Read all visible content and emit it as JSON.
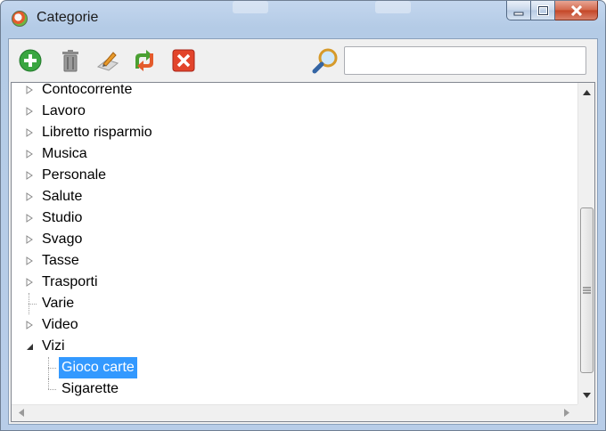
{
  "window": {
    "title": "Categorie"
  },
  "toolbar": {
    "buttons": [
      {
        "name": "add",
        "icon": "add-icon",
        "color": "#3aa641"
      },
      {
        "name": "delete",
        "icon": "trash-icon",
        "color": "#6f6f6f"
      },
      {
        "name": "edit",
        "icon": "edit-icon",
        "color": "#e89a2a"
      },
      {
        "name": "refresh",
        "icon": "refresh-icon",
        "color": "#4aa032"
      },
      {
        "name": "cancel",
        "icon": "cancel-icon",
        "color": "#e2442b"
      }
    ],
    "search": {
      "icon": "magnifier-icon",
      "value": "",
      "placeholder": ""
    }
  },
  "tree": {
    "items": [
      {
        "label": "Contocorrente",
        "level": 0,
        "expander": "collapsed"
      },
      {
        "label": "Lavoro",
        "level": 0,
        "expander": "collapsed"
      },
      {
        "label": "Libretto risparmio",
        "level": 0,
        "expander": "collapsed"
      },
      {
        "label": "Musica",
        "level": 0,
        "expander": "collapsed"
      },
      {
        "label": "Personale",
        "level": 0,
        "expander": "collapsed"
      },
      {
        "label": "Salute",
        "level": 0,
        "expander": "collapsed"
      },
      {
        "label": "Studio",
        "level": 0,
        "expander": "collapsed"
      },
      {
        "label": "Svago",
        "level": 0,
        "expander": "collapsed"
      },
      {
        "label": "Tasse",
        "level": 0,
        "expander": "collapsed"
      },
      {
        "label": "Trasporti",
        "level": 0,
        "expander": "collapsed"
      },
      {
        "label": "Varie",
        "level": 0,
        "expander": "none"
      },
      {
        "label": "Video",
        "level": 0,
        "expander": "collapsed"
      },
      {
        "label": "Vizi",
        "level": 0,
        "expander": "expanded"
      },
      {
        "label": "Gioco carte",
        "level": 1,
        "expander": "none",
        "selected": true
      },
      {
        "label": "Sigarette",
        "level": 1,
        "expander": "none"
      }
    ]
  },
  "colors": {
    "selection": "#3399ff",
    "titlebar": "#b8cde8"
  }
}
